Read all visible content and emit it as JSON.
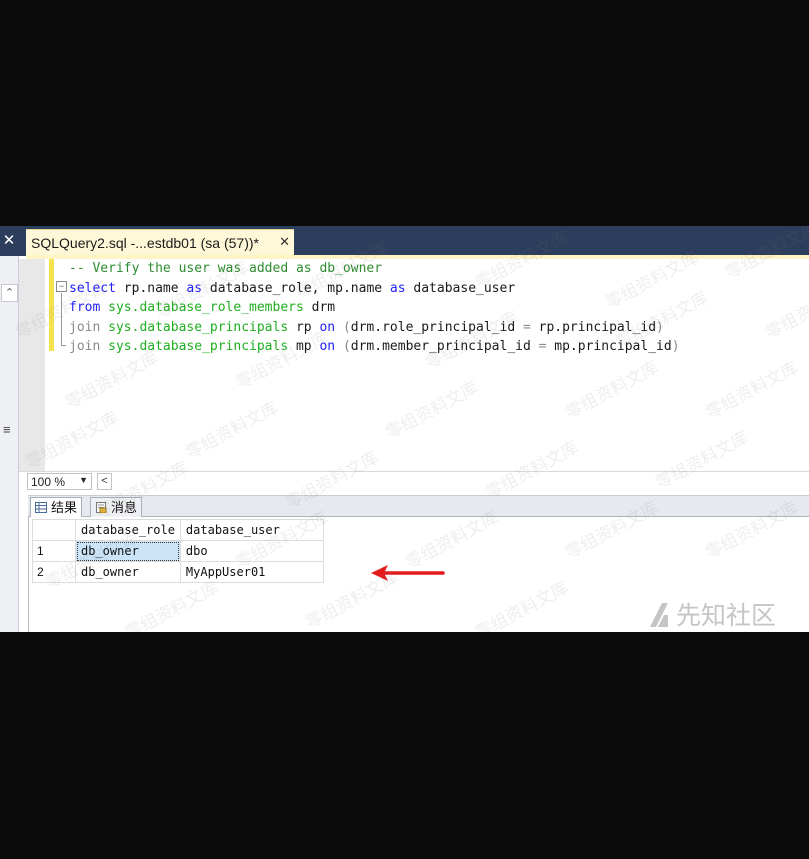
{
  "document_tab": {
    "title": "SQLQuery2.sql -...estdb01 (sa (57))*",
    "close_glyph": "✕"
  },
  "left_panel": {
    "close_glyph": "✕",
    "collapse_glyph": "⌃",
    "menu_glyph": "≡"
  },
  "editor": {
    "collapse_glyph": "−",
    "lines": [
      [
        {
          "t": "-- Verify the user was added as db_owner",
          "c": "cm"
        }
      ],
      [
        {
          "t": "select",
          "c": "kw"
        },
        {
          "t": " rp.name ",
          "c": "tx"
        },
        {
          "t": "as",
          "c": "kw"
        },
        {
          "t": " database_role, mp.name ",
          "c": "tx"
        },
        {
          "t": "as",
          "c": "kw"
        },
        {
          "t": " database_user",
          "c": "tx"
        }
      ],
      [
        {
          "t": "from",
          "c": "kw"
        },
        {
          "t": " ",
          "c": "tx"
        },
        {
          "t": "sys.database_role_members",
          "c": "sy"
        },
        {
          "t": " drm",
          "c": "tx"
        }
      ],
      [
        {
          "t": "join",
          "c": "gr"
        },
        {
          "t": " ",
          "c": "tx"
        },
        {
          "t": "sys.database_principals",
          "c": "sy"
        },
        {
          "t": " rp ",
          "c": "tx"
        },
        {
          "t": "on",
          "c": "kw"
        },
        {
          "t": " ",
          "c": "tx"
        },
        {
          "t": "(",
          "c": "gr"
        },
        {
          "t": "drm.role_principal_id ",
          "c": "tx"
        },
        {
          "t": "=",
          "c": "gr"
        },
        {
          "t": " rp.principal_id",
          "c": "tx"
        },
        {
          "t": ")",
          "c": "gr"
        }
      ],
      [
        {
          "t": "join",
          "c": "gr"
        },
        {
          "t": " ",
          "c": "tx"
        },
        {
          "t": "sys.database_principals",
          "c": "sy"
        },
        {
          "t": " mp ",
          "c": "tx"
        },
        {
          "t": "on",
          "c": "kw"
        },
        {
          "t": " ",
          "c": "tx"
        },
        {
          "t": "(",
          "c": "gr"
        },
        {
          "t": "drm.member_principal_id ",
          "c": "tx"
        },
        {
          "t": "=",
          "c": "gr"
        },
        {
          "t": " mp.principal_id",
          "c": "tx"
        },
        {
          "t": ")",
          "c": "gr"
        }
      ]
    ]
  },
  "zoom": {
    "value": "100 %",
    "dropdown_glyph": "▼",
    "scroll_left_glyph": "<"
  },
  "results_tabs": [
    {
      "label": "结果",
      "icon": "grid-icon",
      "active": true
    },
    {
      "label": "消息",
      "icon": "message-icon",
      "active": false
    }
  ],
  "results": {
    "columns": [
      "database_role",
      "database_user"
    ],
    "rows": [
      {
        "num": "1",
        "cells": [
          "db_owner",
          "dbo"
        ]
      },
      {
        "num": "2",
        "cells": [
          "db_owner",
          "MyAppUser01"
        ]
      }
    ]
  },
  "annotation": {
    "arrow_color": "#e31b1b"
  },
  "watermark": {
    "text": "零组资料文库",
    "brand": "先知社区"
  },
  "colors": {
    "keyword": "#1f1ff5",
    "system_object": "#1fae1f",
    "comment": "#2e8b2e",
    "operator": "#8a8a8a",
    "tab_strip": "#2c3e5c",
    "active_tab": "#fff8d8",
    "selected_cell": "#cce4f7"
  }
}
